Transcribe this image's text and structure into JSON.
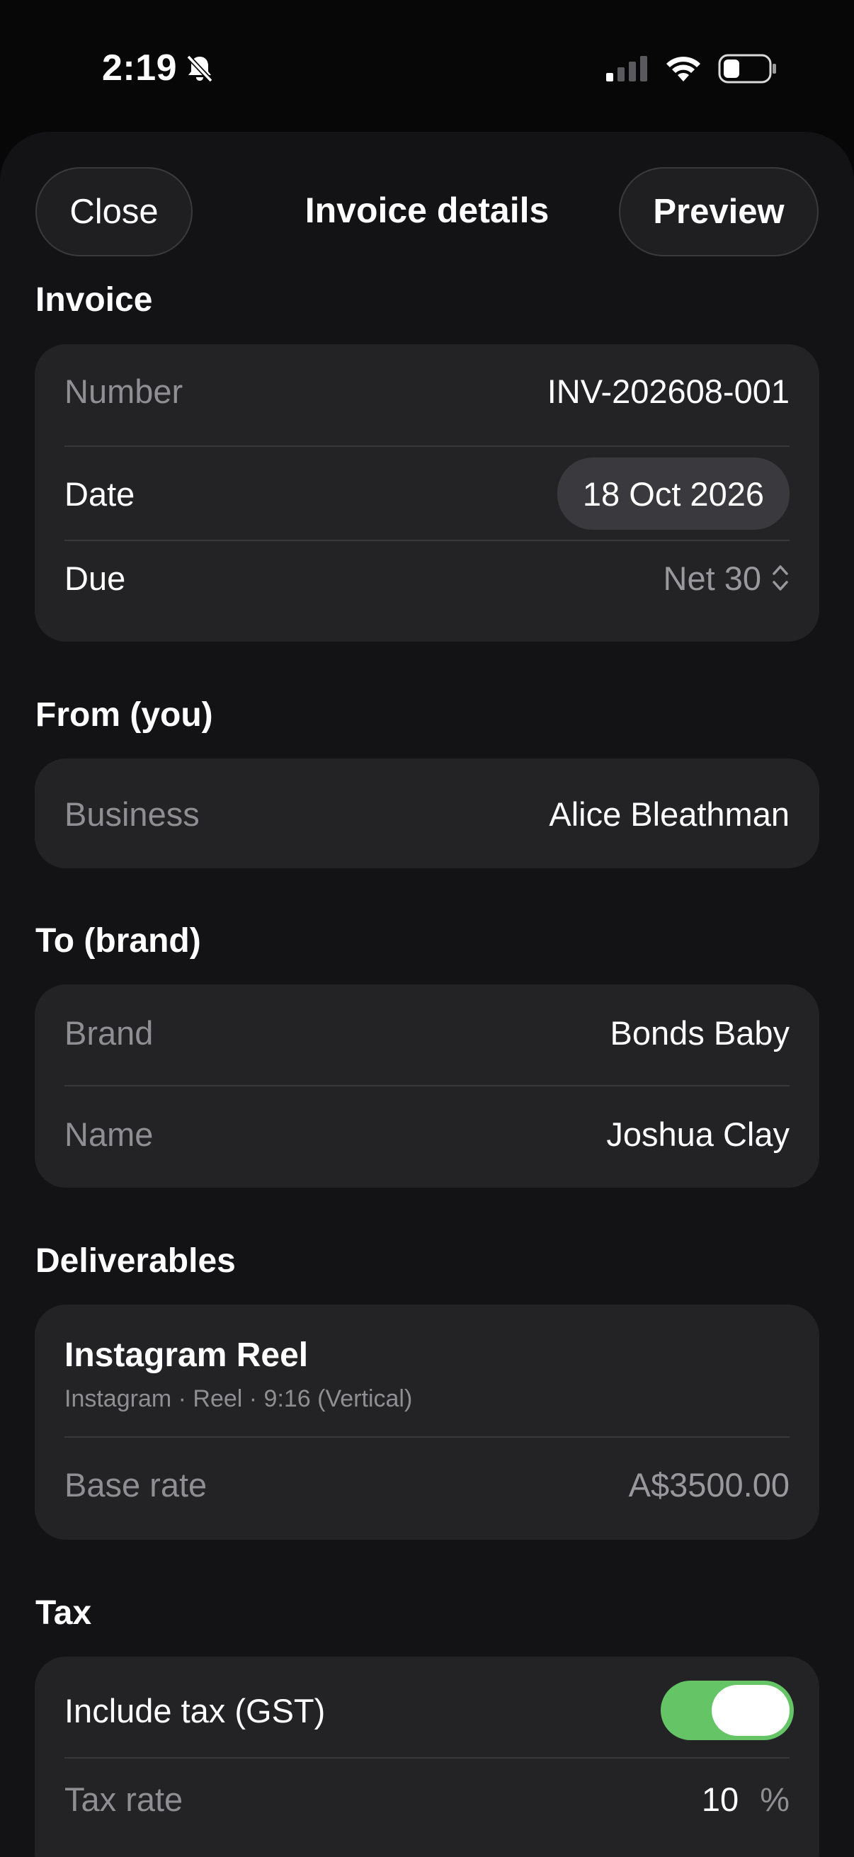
{
  "status_bar": {
    "time": "2:19",
    "icons": [
      "bell-slash-icon",
      "cellular-signal-icon",
      "wifi-icon",
      "battery-icon"
    ]
  },
  "nav": {
    "close_label": "Close",
    "title": "Invoice details",
    "preview_label": "Preview"
  },
  "invoice": {
    "section_title": "Invoice",
    "number_label": "Number",
    "number_value": "INV-202608-001",
    "date_label": "Date",
    "date_value": "18 Oct 2026",
    "due_label": "Due",
    "due_value": "Net 30"
  },
  "from": {
    "section_title": "From (you)",
    "business_label": "Business",
    "business_value": "Alice Bleathman"
  },
  "to": {
    "section_title": "To (brand)",
    "brand_label": "Brand",
    "brand_value": "Bonds Baby",
    "name_label": "Name",
    "name_value": "Joshua Clay"
  },
  "deliverables": {
    "section_title": "Deliverables",
    "item_title": "Instagram Reel",
    "item_subtitle": "Instagram · Reel · 9:16 (Vertical)",
    "base_rate_label": "Base rate",
    "base_rate_value": "A$3500.00"
  },
  "tax": {
    "section_title": "Tax",
    "include_label": "Include tax (GST)",
    "include_on": true,
    "rate_label": "Tax rate",
    "rate_value": "10",
    "rate_unit": "%"
  },
  "colors": {
    "background": "#070708",
    "sheet": "#131315",
    "card": "#232326",
    "toggle_on": "#64c466",
    "dim_text": "#8e8e93"
  }
}
